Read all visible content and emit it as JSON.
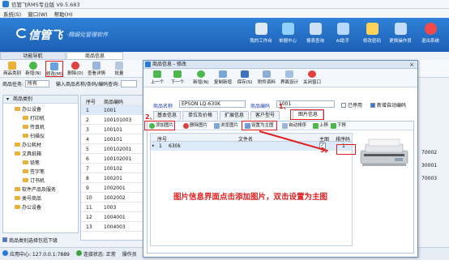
{
  "window": {
    "title": "信管飞RMS专业版 V9.5.683"
  },
  "menu": [
    "系统(S)",
    "窗口(W)",
    "帮助(H)"
  ],
  "banner": {
    "logo": "信管飞",
    "slogan": "·精细化管理软件"
  },
  "top_buttons": [
    {
      "label": "我的工作台",
      "color": "#dfe9f7"
    },
    {
      "label": "单据中心",
      "color": "#8fd0ff"
    },
    {
      "label": "报表查询",
      "color": "#cfe0f4"
    },
    {
      "label": "AI助手",
      "color": "#b7d8ff"
    },
    {
      "label": "修改密码",
      "color": "#ffd35a"
    },
    {
      "label": "更换操作员",
      "color": "#c5ddff"
    },
    {
      "label": "退出系统",
      "color": "#f24a4a"
    }
  ],
  "left_tabs": {
    "function_nav": "功能导航",
    "product_info": "商品信息"
  },
  "main_toolbar": [
    {
      "label": "商品类别"
    },
    {
      "label": "新增(N)"
    },
    {
      "label": "修改(M)"
    },
    {
      "label": "删除(D)"
    },
    {
      "label": "查看详情"
    },
    {
      "label": "批量"
    }
  ],
  "filter": {
    "task_label": "商品任务:",
    "task_value": "所有",
    "search_label": "输入商品名称/条码/编码查询:"
  },
  "tree": {
    "header": "商品类别",
    "nodes": [
      "商品类别",
      "办公设备",
      "打印机",
      "传真机",
      "扫描仪",
      "办公耗材",
      "文具纸箱",
      "铅笔",
      "签字笔",
      "订书机",
      "软件产品及服务",
      "类号商品",
      "办公设备"
    ]
  },
  "grid": {
    "headers": [
      "序号",
      "商品编码"
    ],
    "rows": [
      [
        "1",
        "1001"
      ],
      [
        "2",
        "100101003"
      ],
      [
        "3",
        "100101"
      ],
      [
        "4",
        "100101"
      ],
      [
        "5",
        "100102001"
      ],
      [
        "6",
        "100102001"
      ],
      [
        "7",
        "100102"
      ],
      [
        "8",
        "100201"
      ],
      [
        "9",
        "1002001"
      ],
      [
        "10",
        "1002002"
      ],
      [
        "11",
        "1003"
      ],
      [
        "12",
        "1004001"
      ],
      [
        "13",
        "1004003"
      ]
    ]
  },
  "right_stub": [
    "70002",
    "30001",
    "70003"
  ],
  "include_sub": "商品类别选择包括下级",
  "statusbar": {
    "app_center": "应用中心: 127.0.0.1:7889",
    "conn": "连接状态: 正常",
    "operator": "操作员"
  },
  "dialog": {
    "title": "商品信息 - 修改",
    "toolbar": [
      "上一个",
      "下一个",
      "新增(N)",
      "复制新增",
      "保存(S)",
      "附件资料",
      "界面设计",
      "关闭窗口"
    ],
    "name_label": "商品名称",
    "name_value": "EPSON LQ-630K",
    "code_label": "商品编码",
    "code_value": "1001",
    "disabled_label": "已停用",
    "autocode_label": "新增自动编码",
    "tabs": [
      "基本信息",
      "单位及价格",
      "扩展信息",
      "客户型号",
      "图片信息"
    ],
    "img_toolbar": [
      "添加图片",
      "删除图片",
      "浏览图片",
      "设置为主图",
      "自动排序",
      "上移",
      "下移"
    ],
    "table_headers": [
      "序号",
      "文件名",
      "主图",
      "排序码"
    ],
    "table_row": {
      "index": "1",
      "filename": "630k",
      "main": "✓",
      "sort": "1"
    },
    "annotation": "图片信息界面点击添加图片，双击设置为主图",
    "markers": [
      "1、",
      "2、",
      "3、"
    ]
  }
}
